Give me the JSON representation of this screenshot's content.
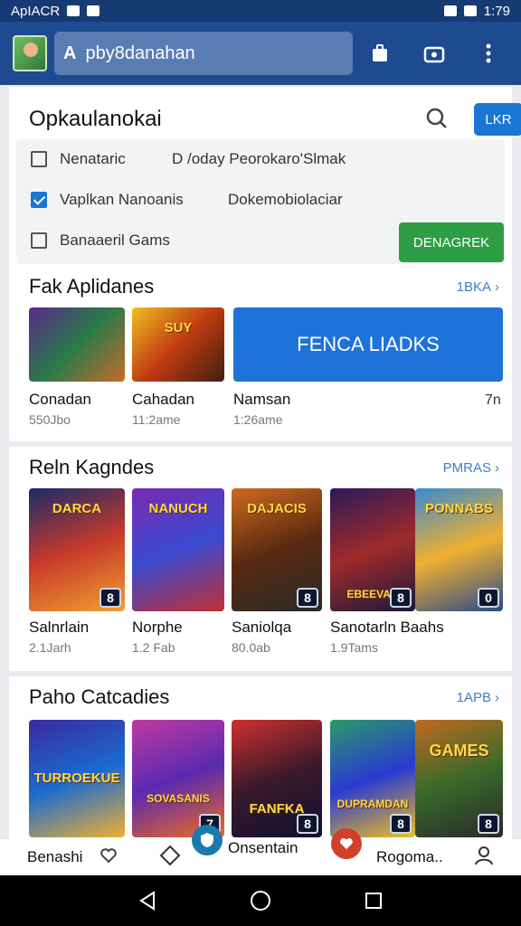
{
  "status_bar": {
    "left_text": "ApIACR",
    "right_text": "1:79"
  },
  "app_bar": {
    "search_prefix": "A",
    "search_text": "pby8danahan",
    "icons": [
      "avatar",
      "bag-icon",
      "camera-icon",
      "more-vert-icon"
    ]
  },
  "main_header": {
    "title": "Opkaulanokai",
    "button_label": "LKR"
  },
  "filters": [
    {
      "label": "Nenataric",
      "checked": false,
      "extra": "D /oday Peorokaro'Slmak"
    },
    {
      "label": "Vaplkan Nanoanis",
      "checked": true,
      "extra": "Dokemobiolaciar"
    },
    {
      "label": "Banaaeril Gams",
      "checked": false,
      "extra": ""
    }
  ],
  "filters_button": "DENAGREK",
  "section1": {
    "title": "Fak Aplidanes",
    "more": "1BKA",
    "items": [
      {
        "name": "Conadan",
        "sub": "550Jbo",
        "overlay": ""
      },
      {
        "name": "Cahadan",
        "sub": "11:2ame",
        "overlay": "SUY"
      },
      {
        "name": "Namsan",
        "sub": "1:26ame",
        "overlay": ""
      }
    ],
    "feature_label": "FENCA LIADKS",
    "extra_count": "7n"
  },
  "section2": {
    "title": "Reln Kagndes",
    "more": "PMRAS",
    "items": [
      {
        "name": "Salnrlain",
        "sub": "2.1Jarh",
        "badge": "8",
        "overlay": "DARCA"
      },
      {
        "name": "Norphe",
        "sub": "1.2 Fab",
        "badge": "",
        "overlay": "NANUCH"
      },
      {
        "name": "Saniolqa",
        "sub": "80.0ab",
        "badge": "8",
        "overlay": "DAJACIS"
      },
      {
        "name": "Sanotarln Baahs",
        "sub": "1.9Tams",
        "badge": "8",
        "overlay": "EBEEVAR"
      },
      {
        "name": "",
        "sub": "",
        "badge": "0",
        "overlay": "PONNABS"
      }
    ]
  },
  "section3": {
    "title": "Paho Catcadies",
    "more": "1APB",
    "items": [
      {
        "badge": "",
        "overlay": "TURROEKUE"
      },
      {
        "badge": "7",
        "overlay": "SOVASANIS"
      },
      {
        "badge": "8",
        "overlay": "FANFKA"
      },
      {
        "badge": "8",
        "overlay": "DUPRAMDAN"
      },
      {
        "badge": "8",
        "overlay": "GAMES"
      }
    ]
  },
  "bottom_nav": {
    "item1": "Benashi",
    "item2": "Onsentain",
    "item3": "Rogoma.."
  },
  "colors": {
    "primary": "#1e4b8f",
    "accent_blue": "#1976d2",
    "accent_green": "#2e9e45"
  }
}
